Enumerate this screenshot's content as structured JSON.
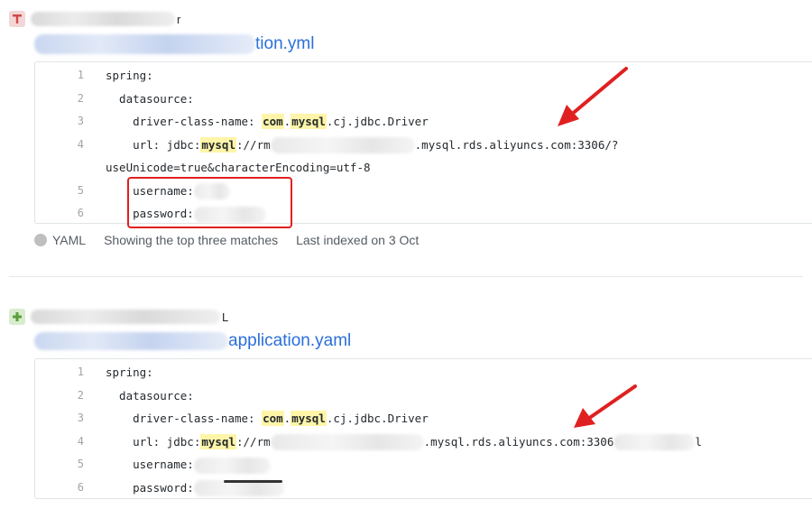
{
  "results": [
    {
      "repo_suffix": "r",
      "file_suffix": "tion.yml",
      "lines": [
        {
          "n": "1",
          "segments": [
            {
              "t": "spring:"
            }
          ]
        },
        {
          "n": "2",
          "segments": [
            {
              "t": "  datasource:"
            }
          ]
        },
        {
          "n": "3",
          "segments": [
            {
              "t": "    driver-class-name: "
            },
            {
              "t": "com",
              "hl": true
            },
            {
              "t": "."
            },
            {
              "t": "mysql",
              "hl": true
            },
            {
              "t": ".cj.jdbc.Driver"
            }
          ]
        },
        {
          "n": "4",
          "segments": [
            {
              "t": "    url: jdbc:"
            },
            {
              "t": "mysql",
              "hl": true
            },
            {
              "t": "://rm"
            },
            {
              "t": "",
              "blur": 160
            },
            {
              "t": ".mysql.rds.aliyuncs.com:3306/?"
            }
          ]
        },
        {
          "n": "",
          "segments": [
            {
              "t": "useUnicode=true&characterEncoding=utf-8"
            }
          ]
        },
        {
          "n": "5",
          "segments": [
            {
              "t": "    username:"
            },
            {
              "t": "",
              "blur": 40
            }
          ]
        },
        {
          "n": "6",
          "segments": [
            {
              "t": "    password:"
            },
            {
              "t": "",
              "blur": 80
            }
          ]
        }
      ],
      "language": "YAML",
      "match_text": "Showing the top three matches",
      "indexed_text": "Last indexed on 3 Oct"
    },
    {
      "repo_suffix": "L",
      "file_suffix": "application.yaml",
      "lines": [
        {
          "n": "1",
          "segments": [
            {
              "t": "spring:"
            }
          ]
        },
        {
          "n": "2",
          "segments": [
            {
              "t": "  datasource:"
            }
          ]
        },
        {
          "n": "3",
          "segments": [
            {
              "t": "    driver-class-name: "
            },
            {
              "t": "com",
              "hl": true
            },
            {
              "t": "."
            },
            {
              "t": "mysql",
              "hl": true
            },
            {
              "t": ".cj.jdbc.Driver"
            }
          ]
        },
        {
          "n": "4",
          "segments": [
            {
              "t": "    url: jdbc:"
            },
            {
              "t": "mysql",
              "hl": true
            },
            {
              "t": "://rm"
            },
            {
              "t": "",
              "blur": 170
            },
            {
              "t": ".mysql.rds.aliyuncs.com:3306"
            },
            {
              "t": "",
              "blur": 90
            },
            {
              "t": "l"
            }
          ]
        },
        {
          "n": "5",
          "segments": [
            {
              "t": "    username:"
            },
            {
              "t": "",
              "blur": 85
            }
          ]
        },
        {
          "n": "6",
          "segments": [
            {
              "t": "    password:"
            },
            {
              "t": "",
              "blur": 100
            }
          ]
        }
      ]
    }
  ],
  "colors": {
    "link": "#2a6fdb",
    "highlight": "#fff5a8",
    "annotation": "#e02020"
  },
  "icons": [
    "repo-avatar-red-icon",
    "repo-avatar-green-icon",
    "language-dot-icon",
    "annotation-arrow-icon"
  ]
}
